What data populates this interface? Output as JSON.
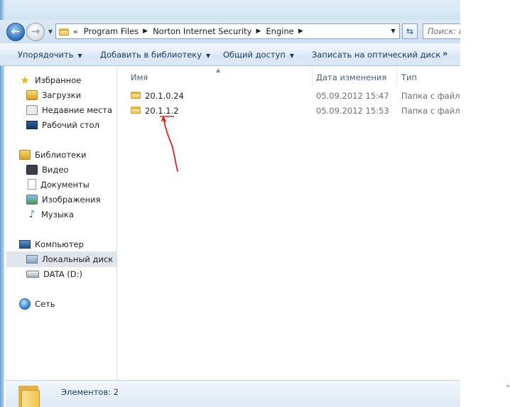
{
  "address": {
    "overflow": "«",
    "crumbs": [
      "Program Files",
      "Norton Internet Security",
      "Engine"
    ],
    "search_placeholder": "Поиск: E"
  },
  "toolbar": {
    "organize": "Упорядочить",
    "add_to_library": "Добавить в библиотеку",
    "share": "Общий доступ",
    "burn": "Записать на оптический диск",
    "more": "»"
  },
  "navpane": {
    "favorites": {
      "label": "Избранное",
      "items": [
        "Загрузки",
        "Недавние места",
        "Рабочий стол"
      ]
    },
    "libraries": {
      "label": "Библиотеки",
      "items": [
        "Видео",
        "Документы",
        "Изображения",
        "Музыка"
      ]
    },
    "computer": {
      "label": "Компьютер",
      "items": [
        "Локальный диск (C",
        "DATA (D:)"
      ]
    },
    "network": {
      "label": "Сеть"
    }
  },
  "columns": {
    "name": "Имя",
    "date": "Дата изменения",
    "type": "Тип"
  },
  "files": [
    {
      "name": "20.1.0.24",
      "date": "05.09.2012 15:47",
      "type": "Папка с файла"
    },
    {
      "name": "20.1.1.2",
      "date": "05.09.2012 15:53",
      "type": "Папка с файла"
    }
  ],
  "status": {
    "items_text": "Элементов: 2"
  },
  "colors": {
    "toolbar_text": "#1e395b",
    "annotation": "#e02020"
  }
}
